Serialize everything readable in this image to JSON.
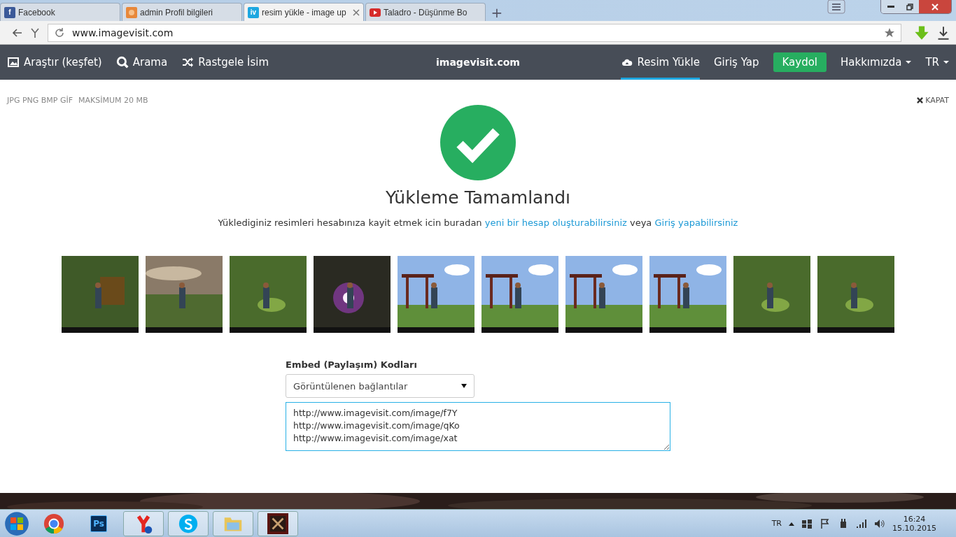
{
  "browser_tabs": [
    {
      "label": "Facebook",
      "selected": false,
      "icon": {
        "kind": "facebook",
        "label": "f"
      }
    },
    {
      "label": "admin Profil bilgileri",
      "selected": false,
      "icon": {
        "kind": "profile"
      }
    },
    {
      "label": "resim yükle - image up",
      "selected": true,
      "icon": {
        "kind": "site",
        "label": "iv"
      }
    },
    {
      "label": "Taladro - Düşünme Bo",
      "selected": false,
      "icon": {
        "kind": "video"
      }
    }
  ],
  "new_tab": "+",
  "address": "www.imagevisit.com",
  "nav": {
    "left": [
      {
        "label": "Araştır (keşfet)",
        "kind": "explore"
      },
      {
        "label": "Arama",
        "kind": "search"
      },
      {
        "label": "Rastgele İsim",
        "kind": "random"
      }
    ],
    "logo": "imagevisit.com",
    "right": [
      {
        "label": "Resim Yükle",
        "kind": "upload",
        "selected": true
      },
      {
        "label": "Giriş Yap",
        "kind": "link",
        "selected": false
      },
      {
        "label": "Kaydol",
        "kind": "button",
        "selected": false
      },
      {
        "label": "Hakkımızda",
        "kind": "dropdown",
        "selected": false
      },
      {
        "label": "TR",
        "kind": "dropdown",
        "selected": false
      }
    ]
  },
  "upload_info": {
    "formats": "JPG PNG BMP GİF",
    "max_size": "MAKSİMUM 20 MB",
    "close": "KAPAT"
  },
  "title": "Yükleme Tamamlandı",
  "message": [
    {
      "kind": "text",
      "text": "Yüklediginiz resimleri hesabınıza kayit etmek icin buradan "
    },
    {
      "kind": "link",
      "text": "yeni bir hesap oluşturabilirsiniz"
    },
    {
      "kind": "text",
      "text": " veya "
    },
    {
      "kind": "link",
      "text": "Giriş yapabilirsiniz"
    }
  ],
  "embed": {
    "label": "Embed (Paylaşım) Kodları",
    "select": "Görüntülenen bağlantılar",
    "lines": [
      "http://www.imagevisit.com/image/f7Y",
      "http://www.imagevisit.com/image/qKo",
      "http://www.imagevisit.com/image/xat"
    ]
  },
  "taskbar": {
    "apps": [
      {
        "kind": "chrome",
        "active": false
      },
      {
        "kind": "photoshop",
        "label": "Ps",
        "active": false
      },
      {
        "kind": "yandex",
        "active": true
      },
      {
        "kind": "skype",
        "active": true
      },
      {
        "kind": "folder",
        "active": true
      },
      {
        "kind": "game",
        "active": true
      }
    ],
    "language": "TR",
    "time": "16:24",
    "date": "15.10.2015"
  }
}
